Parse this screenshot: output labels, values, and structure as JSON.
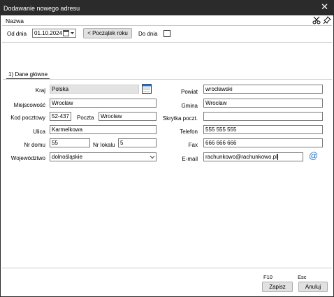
{
  "window": {
    "title": "Dodawanie nowego adresu",
    "close_glyph": "✕"
  },
  "toolbar": {
    "name_label": "Nazwa",
    "icons": [
      "scissors-icon",
      "pin-icon"
    ]
  },
  "date_row": {
    "od_dnia_label": "Od dnia",
    "od_dnia_value": "01.10.2024",
    "start_button": "< Początek roku",
    "do_dnia_label": "Do dnia",
    "do_dnia_checked": false
  },
  "tab": {
    "label": "1) Dane główne"
  },
  "left": {
    "kraj_label": "Kraj",
    "kraj_value": "Polska",
    "miejscowosc_label": "Miejscowość",
    "miejscowosc_value": "Wrocław",
    "kod_label": "Kod pocztowy",
    "kod_value": "52-437",
    "poczta_label": "Poczta",
    "poczta_value": "Wrocław",
    "ulica_label": "Ulica",
    "ulica_value": "Karmelkowa",
    "nr_domu_label": "Nr domu",
    "nr_domu_value": "55",
    "nr_lokalu_label": "Nr lokalu",
    "nr_lokalu_value": "5",
    "wojewodztwo_label": "Województwo",
    "wojewodztwo_value": "dolnośląskie"
  },
  "right": {
    "powiat_label": "Powiat",
    "powiat_value": "wrocławski",
    "gmina_label": "Gmina",
    "gmina_value": "Wrocław",
    "skrytka_label": "Skrytka poczt.",
    "skrytka_value": "",
    "telefon_label": "Telefon",
    "telefon_value": "555 555 555",
    "fax_label": "Fax",
    "fax_value": "666 666 666",
    "email_label": "E-mail",
    "email_value": "rachunkowo@rachunkowo.pl",
    "email_icon_glyph": "@"
  },
  "footer": {
    "save_key": "F10",
    "save_label": "Zapisz",
    "cancel_key": "Esc",
    "cancel_label": "Anuluj"
  },
  "colors": {
    "titlebar": "#2b2b2b",
    "email_icon": "#1e73c8"
  }
}
